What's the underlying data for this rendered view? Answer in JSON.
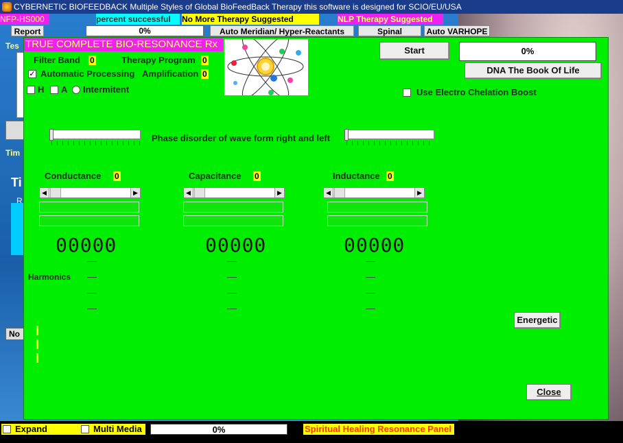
{
  "window": {
    "title": "CYBERNETIC BIOFEEDBACK  Multiple Styles of Global BioFeedBack Therapy  this software is designed for SCIO/EU/USA"
  },
  "top_strip": {
    "nfp_label": "NFP-HS000",
    "percent_successful": "percent successful",
    "no_more_therapy": "No More Therapy Suggested",
    "nlp_therapy": "NLP Therapy Suggested"
  },
  "top_buttons": {
    "report": "Report",
    "progress": "0%",
    "auto_meridian": "Auto Meridian/ Hyper-Reactants",
    "spinal": "Spinal",
    "auto_varhope": "Auto VARHOPE"
  },
  "side_fragments": {
    "tes": "Tes",
    "tim": "Tim",
    "ti": "Ti",
    "r": "R",
    "no": "No"
  },
  "panel": {
    "title": "TRUE COMPLETE BIO-RESONANCE Rx",
    "filter_band_label": "Filter Band",
    "filter_band_value": "0",
    "therapy_program_label": "Therapy Program",
    "therapy_program_value": "0",
    "automatic_processing_label": "Automatic Processing",
    "amplification_label": "Amplification",
    "amplification_value": "0",
    "h_label": "H",
    "a_label": "A",
    "intermitent_label": "Intermitent",
    "start_label": "Start",
    "progress": "0%",
    "dna_label": "DNA The Book Of Life",
    "electro_chelation_label": "Use Electro Chelation Boost",
    "phase_label": "Phase disorder of wave form right and left",
    "conductance_label": "Conductance",
    "conductance_value": "0",
    "capacitance_label": "Capacitance",
    "capacitance_value": "0",
    "inductance_label": "Inductance",
    "inductance_value": "0",
    "conductance_digits": "00000",
    "capacitance_digits": "00000",
    "inductance_digits": "00000",
    "harmonics_label": "Harmonics",
    "energetic_label": "Energetic",
    "close_label": "Close"
  },
  "bottom_bar": {
    "expand_label": "Expand",
    "multi_media_label": "Multi Media",
    "progress": "0%",
    "spiritual_label": "Spiritual Healing Resonance Panel"
  },
  "colors": {
    "panel": "#00ee00",
    "title_bg": "#ee22ee",
    "highlight": "#ffff00",
    "cyan": "#00ffff"
  }
}
